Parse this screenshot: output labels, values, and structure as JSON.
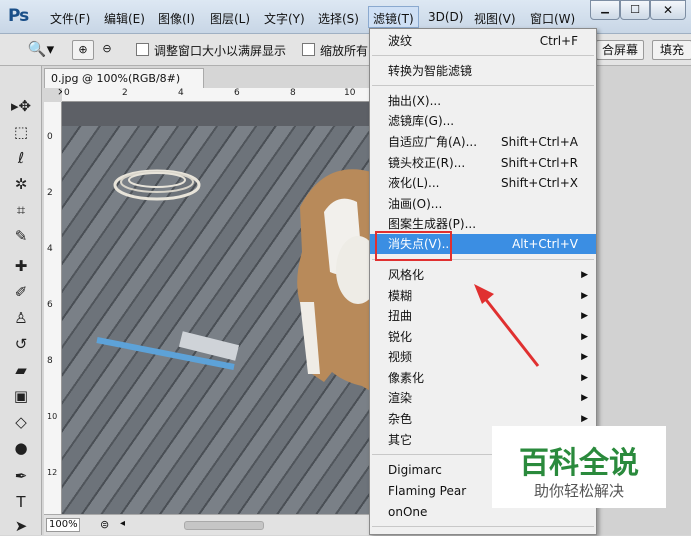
{
  "app": {
    "logo": "Ps"
  },
  "menubar": {
    "items": [
      {
        "label": "文件(F)"
      },
      {
        "label": "编辑(E)"
      },
      {
        "label": "图像(I)"
      },
      {
        "label": "图层(L)"
      },
      {
        "label": "文字(Y)"
      },
      {
        "label": "选择(S)"
      },
      {
        "label": "滤镜(T)"
      },
      {
        "label": "3D(D)"
      },
      {
        "label": "视图(V)"
      },
      {
        "label": "窗口(W)"
      }
    ]
  },
  "window_controls": {
    "minimize": "▁",
    "maximize": "☐",
    "close": "✕"
  },
  "options_bar": {
    "resize_window_label": "调整窗口大小以满屏显示",
    "zoom_all_label": "缩放所有",
    "fill_screen_button": "合屏幕",
    "fill_button": "填充"
  },
  "document": {
    "tab_title": "0.jpg @ 100%(RGB/8#)",
    "tab_close": "×",
    "zoom_level": "100%"
  },
  "ruler_top": [
    "0",
    "2",
    "4",
    "6",
    "8",
    "10"
  ],
  "ruler_left": [
    "0",
    "2",
    "4",
    "6",
    "8",
    "10",
    "12"
  ],
  "filter_menu": {
    "items": [
      {
        "label": "波纹",
        "shortcut": "Ctrl+F"
      },
      {
        "label": "转换为智能滤镜",
        "shortcut": ""
      },
      {
        "label": "抽出(X)...",
        "shortcut": ""
      },
      {
        "label": "滤镜库(G)...",
        "shortcut": ""
      },
      {
        "label": "自适应广角(A)...",
        "shortcut": "Shift+Ctrl+A"
      },
      {
        "label": "镜头校正(R)...",
        "shortcut": "Shift+Ctrl+R"
      },
      {
        "label": "液化(L)...",
        "shortcut": "Shift+Ctrl+X"
      },
      {
        "label": "油画(O)...",
        "shortcut": ""
      },
      {
        "label": "图案生成器(P)...",
        "shortcut": ""
      },
      {
        "label": "消失点(V)...",
        "shortcut": "Alt+Ctrl+V",
        "highlighted": true
      },
      {
        "label": "风格化",
        "shortcut": "",
        "submenu": true
      },
      {
        "label": "模糊",
        "shortcut": "",
        "submenu": true
      },
      {
        "label": "扭曲",
        "shortcut": "",
        "submenu": true
      },
      {
        "label": "锐化",
        "shortcut": "",
        "submenu": true
      },
      {
        "label": "视频",
        "shortcut": "",
        "submenu": true
      },
      {
        "label": "像素化",
        "shortcut": "",
        "submenu": true
      },
      {
        "label": "渲染",
        "shortcut": "",
        "submenu": true
      },
      {
        "label": "杂色",
        "shortcut": "",
        "submenu": true
      },
      {
        "label": "其它",
        "shortcut": "",
        "submenu": true
      },
      {
        "label": "Digimarc",
        "shortcut": "",
        "submenu": true
      },
      {
        "label": "Flaming Pear",
        "shortcut": "",
        "submenu": true
      },
      {
        "label": "onOne",
        "shortcut": "",
        "submenu": true
      }
    ]
  },
  "watermark": {
    "title": "百科全说",
    "subtitle": "助你轻松解决"
  },
  "colors": {
    "highlight": "#3b8ee3",
    "annotation": "#e03030",
    "watermark": "#2a8a3c"
  }
}
